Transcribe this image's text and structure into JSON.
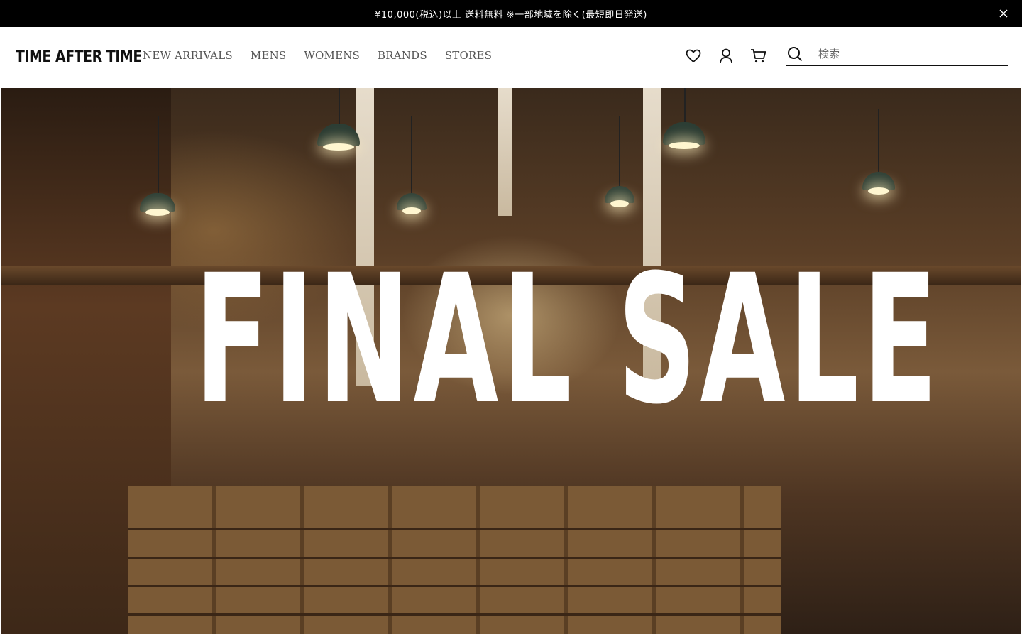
{
  "announcement": {
    "text": "¥10,000(税込)以上 送料無料 ※一部地域を除く(最短即日発送)",
    "close_icon": "close-icon"
  },
  "header": {
    "logo": "TIME AFTER TIME",
    "nav": [
      {
        "label": "NEW ARRIVALS"
      },
      {
        "label": "MENS"
      },
      {
        "label": "WOMENS"
      },
      {
        "label": "BRANDS"
      },
      {
        "label": "STORES"
      }
    ],
    "icons": [
      "heart-icon",
      "user-icon",
      "cart-icon"
    ],
    "search": {
      "placeholder": "検索",
      "value": ""
    }
  },
  "hero": {
    "title": "FINAL SALE"
  },
  "colors": {
    "announcement_bg": "#000000",
    "text_primary": "#111111",
    "nav_text": "#555555",
    "hero_title": "#ffffff"
  }
}
